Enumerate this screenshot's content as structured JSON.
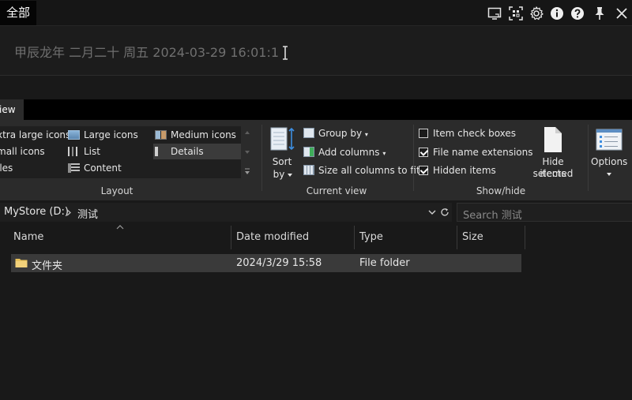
{
  "launcher": {
    "tab_all": "全部",
    "input_text": "甲辰龙年 二月二十 周五 2024-03-29 16:01:1",
    "icons": [
      "screen-icon",
      "scan-icon",
      "gear-icon",
      "info-icon",
      "help-icon",
      "pin-icon",
      "close-icon"
    ]
  },
  "ribbon": {
    "tab_view": "iew",
    "layout": {
      "items": [
        "xtra large icons",
        "Large icons",
        "Medium icons",
        "mall icons",
        "List",
        "Details",
        "iles",
        "Content"
      ],
      "label": "Layout"
    },
    "current_view": {
      "sort_label_1": "Sort",
      "sort_label_2": "by",
      "group_by": "Group by",
      "add_columns": "Add columns",
      "size_all": "Size all columns to fit",
      "label": "Current view"
    },
    "show_hide": {
      "item_check_boxes": "Item check boxes",
      "file_name_extensions": "File name extensions",
      "hidden_items": "Hidden items",
      "hide_selected_1": "Hide selected",
      "hide_selected_2": "items",
      "label": "Show/hide",
      "checks": {
        "item_check_boxes": false,
        "file_name_extensions": true,
        "hidden_items": true
      }
    },
    "options": "Options"
  },
  "address": {
    "drive": "MyStore (D:)",
    "folder": "测试",
    "search_placeholder": "Search 测试"
  },
  "list": {
    "columns": [
      "Name",
      "Date modified",
      "Type",
      "Size"
    ],
    "rows": [
      {
        "name": "文件夹",
        "date": "2024/3/29 15:58",
        "type": "File folder",
        "size": ""
      }
    ]
  },
  "colors": {
    "bg": "#191919",
    "ribbon": "#2b2b2b",
    "selected_row": "#3a3a3a",
    "folder": "#e8c15a"
  }
}
